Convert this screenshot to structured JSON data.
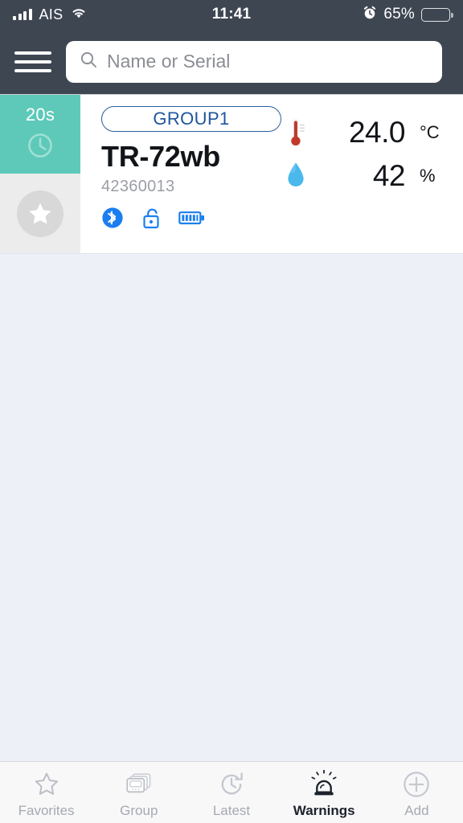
{
  "status_bar": {
    "carrier": "AIS",
    "signal_icon": "signal-bars-icon",
    "wifi_icon": "wifi-icon",
    "time": "11:41",
    "alarm_icon": "alarm-clock-icon",
    "battery_percent": "65%",
    "battery_level": 65,
    "battery_icon": "battery-icon"
  },
  "header": {
    "menu_icon": "hamburger-menu-icon",
    "search_icon": "search-icon",
    "search_placeholder": "Name or Serial",
    "search_value": ""
  },
  "device_card": {
    "interval_label": "20s",
    "interval_icon": "clock-icon",
    "favorite_icon": "star-icon",
    "group_label": "GROUP1",
    "device_name": "TR-72wb",
    "serial": "42360013",
    "status_icons": [
      {
        "name": "bluetooth-icon",
        "state": "connected"
      },
      {
        "name": "unlock-icon",
        "state": "unlocked"
      },
      {
        "name": "battery-full-icon",
        "state": "full"
      }
    ],
    "readings": [
      {
        "icon": "thermometer-icon",
        "value": "24.0",
        "unit": "°C",
        "type": "temperature"
      },
      {
        "icon": "water-drop-icon",
        "value": "42",
        "unit": "%",
        "type": "humidity"
      }
    ]
  },
  "tab_bar": {
    "tabs": [
      {
        "label": "Favorites",
        "icon": "star-outline-icon",
        "active": false
      },
      {
        "label": "Group",
        "icon": "device-stack-icon",
        "active": false
      },
      {
        "label": "Latest",
        "icon": "refresh-clock-icon",
        "active": false
      },
      {
        "label": "Warnings",
        "icon": "siren-icon",
        "active": true
      },
      {
        "label": "Add",
        "icon": "plus-circle-icon",
        "active": false
      }
    ]
  },
  "colors": {
    "header_bg": "#3e4652",
    "interval_teal": "#5ec9b8",
    "body_bg": "#eef0f8",
    "accent_blue": "#1a7ef0",
    "group_border": "#2f5f9e",
    "temperature_red": "#c0392b",
    "humidity_blue": "#4bb8ec",
    "tab_inactive": "#a6a9b2",
    "tab_active": "#1c222c"
  }
}
